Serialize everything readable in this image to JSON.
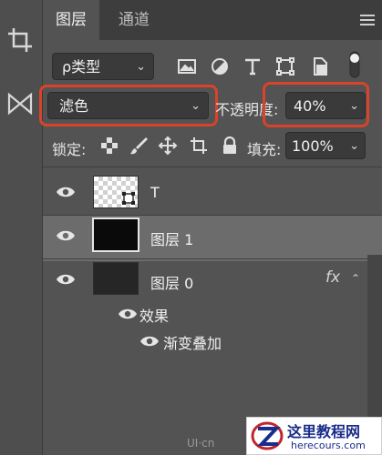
{
  "tabs": {
    "layers": "图层",
    "channels": "通道"
  },
  "filter": {
    "label": "ρ类型"
  },
  "blend": {
    "mode": "滤色"
  },
  "opacity": {
    "label": "不透明度:",
    "value": "40%"
  },
  "lock": {
    "label": "锁定:"
  },
  "fill": {
    "label": "填充:",
    "value": "100%"
  },
  "layers": [
    {
      "name": "T",
      "selected": false
    },
    {
      "name": "图层 1",
      "selected": true
    },
    {
      "name": "图层 0",
      "selected": false,
      "fx": "fx"
    }
  ],
  "effects": {
    "label": "效果",
    "items": [
      "渐变叠加"
    ]
  },
  "watermark": {
    "text": "UI·cn"
  },
  "badge": {
    "title": "这里教程网",
    "url": "herecours.com"
  },
  "colors": {
    "highlight": "#d9432a",
    "panel": "#535353",
    "selected_row": "#6c6c6c"
  }
}
